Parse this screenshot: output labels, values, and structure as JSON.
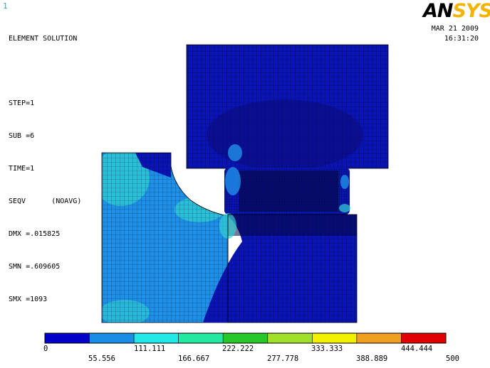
{
  "window_number": "1",
  "info_lines": [
    "ELEMENT SOLUTION",
    "",
    "STEP=1",
    "SUB =6",
    "TIME=1",
    "SEQV      (NOAVG)",
    "DMX =.015825",
    "SMN =.609605",
    "SMX =1093"
  ],
  "logo": {
    "part1": "AN",
    "part2": "SYS",
    "colors": {
      "an": "#000000",
      "sys": "#f2b400"
    }
  },
  "date": "MAR 21 2009",
  "time": "16:31:20",
  "legend": {
    "colors": [
      "#0000c8",
      "#1a8ee6",
      "#22e8e8",
      "#22e8a0",
      "#28c828",
      "#a0e028",
      "#f0f000",
      "#f0a020",
      "#e00000"
    ],
    "upper_labels": [
      "0",
      "111.111",
      "222.222",
      "333.333",
      "444.444"
    ],
    "lower_labels": [
      "55.556",
      "166.667",
      "277.778",
      "388.889",
      "500"
    ]
  },
  "mesh_colors": {
    "low": "#0a14b4",
    "mid": "#1e90e8",
    "high": "#30d2d2",
    "hot": "#3cd296"
  }
}
